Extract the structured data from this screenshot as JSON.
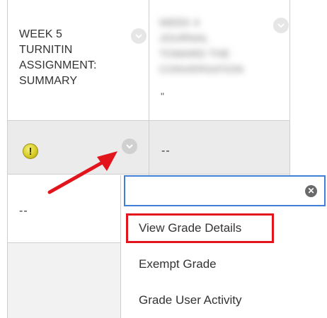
{
  "columns": [
    {
      "title": "WEEK 5\nTURNITIN\nASSIGNMENT:\nSUMMARY"
    },
    {
      "title_blurred": "WEEK 4\nJOURNAL\nTOWARD THE\nCONVERSATION",
      "title_tail": "\""
    }
  ],
  "rows": [
    {
      "col1_status": "needs-grading",
      "col1_icon_glyph": "!",
      "col2_value": "--"
    },
    {
      "col1_value": "--"
    }
  ],
  "context_menu": {
    "search_value": "",
    "clear_glyph": "✕",
    "items": [
      "View Grade Details",
      "Exempt Grade",
      "Grade User Activity"
    ],
    "highlighted_item": "View Grade Details"
  },
  "annotation": {
    "arrow_color": "#e2141c",
    "highlight_color": "#e2141c"
  },
  "colors": {
    "accent": "#3f7fd6",
    "warning": "#d8cc2a"
  }
}
